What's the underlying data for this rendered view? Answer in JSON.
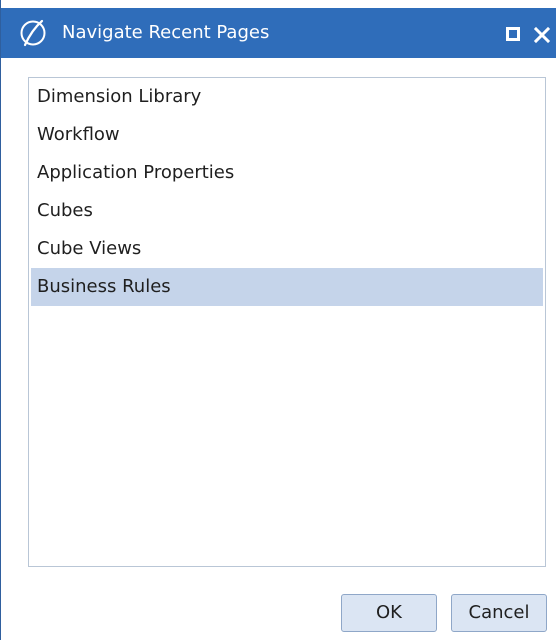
{
  "dialog": {
    "title": "Navigate Recent Pages",
    "title_icon": "app-logo-icon",
    "window_controls": [
      "maximize-icon",
      "close-icon"
    ],
    "colors": {
      "titlebar": "#2f6dba",
      "selected_row": "#c5d4ea",
      "button_bg": "#dbe5f3"
    }
  },
  "recent_pages": {
    "items": [
      {
        "label": "Dimension Library",
        "selected": false
      },
      {
        "label": "Workflow",
        "selected": false
      },
      {
        "label": "Application Properties",
        "selected": false
      },
      {
        "label": "Cubes",
        "selected": false
      },
      {
        "label": "Cube Views",
        "selected": false
      },
      {
        "label": "Business Rules",
        "selected": true
      }
    ]
  },
  "buttons": {
    "ok_label": "OK",
    "cancel_label": "Cancel"
  }
}
